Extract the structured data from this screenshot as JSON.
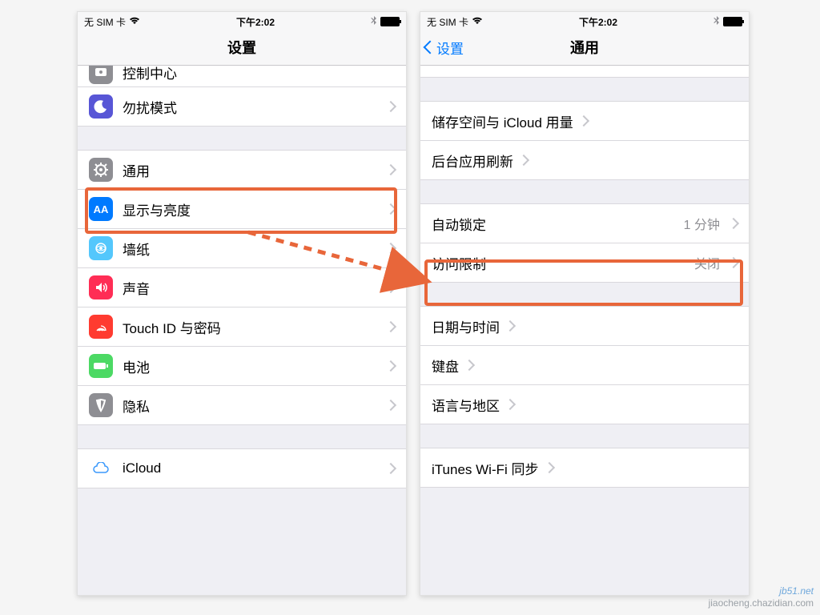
{
  "status": {
    "carrier": "无 SIM 卡",
    "wifi_icon": "wifi",
    "time": "下午2:02",
    "bt_icon": "bluetooth",
    "battery_icon": "battery"
  },
  "colors": {
    "highlight": "#e8663a",
    "ios_blue": "#007aff"
  },
  "left": {
    "title": "设置",
    "partial_top": {
      "label": "控制中心",
      "icon": "control-center"
    },
    "rows1": [
      {
        "label": "勿扰模式",
        "icon": "do-not-disturb",
        "icon_bg": "#5856d6"
      }
    ],
    "rows2": [
      {
        "label": "通用",
        "icon": "general",
        "icon_bg": "#8e8e93",
        "highlight": true
      },
      {
        "label": "显示与亮度",
        "icon": "display",
        "icon_bg": "#007aff"
      },
      {
        "label": "墙纸",
        "icon": "wallpaper",
        "icon_bg": "#54c7fc"
      },
      {
        "label": "声音",
        "icon": "sound",
        "icon_bg": "#ff2d55"
      },
      {
        "label": "Touch ID 与密码",
        "icon": "touchid",
        "icon_bg": "#ff3b30"
      },
      {
        "label": "电池",
        "icon": "battery",
        "icon_bg": "#4cd964"
      },
      {
        "label": "隐私",
        "icon": "privacy",
        "icon_bg": "#8e8e93"
      }
    ],
    "rows3": [
      {
        "label": "iCloud",
        "icon": "icloud",
        "icon_bg": "#ffffff"
      }
    ]
  },
  "right": {
    "back": "设置",
    "title": "通用",
    "groups": [
      [
        {
          "label": "储存空间与 iCloud 用量"
        },
        {
          "label": "后台应用刷新"
        }
      ],
      [
        {
          "label": "自动锁定",
          "value": "1 分钟",
          "highlight": true
        },
        {
          "label": "访问限制",
          "value": "关闭"
        }
      ],
      [
        {
          "label": "日期与时间"
        },
        {
          "label": "键盘"
        },
        {
          "label": "语言与地区"
        }
      ],
      [
        {
          "label": "iTunes Wi-Fi 同步"
        }
      ]
    ]
  },
  "watermark": {
    "line1": "jb51.net",
    "line2": "jiaocheng.chazidian.com"
  }
}
